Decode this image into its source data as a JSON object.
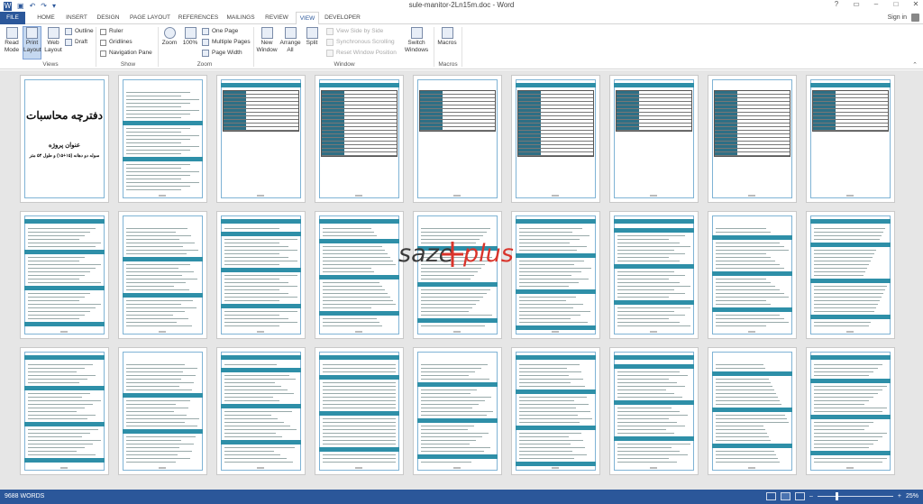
{
  "window": {
    "title": "sule-manitor-2Ln15m.doc - Word",
    "sign_in": "Sign in",
    "controls": [
      "?",
      "▭",
      "–",
      "□",
      "✕"
    ]
  },
  "tabs": [
    "FILE",
    "HOME",
    "INSERT",
    "DESIGN",
    "PAGE LAYOUT",
    "REFERENCES",
    "MAILINGS",
    "REVIEW",
    "VIEW",
    "DEVELOPER"
  ],
  "active_tab": "VIEW",
  "ribbon": {
    "views": {
      "label": "Views",
      "read_mode": "Read Mode",
      "print_layout": "Print Layout",
      "web_layout": "Web Layout",
      "outline": "Outline",
      "draft": "Draft"
    },
    "show": {
      "label": "Show",
      "ruler": "Ruler",
      "gridlines": "Gridlines",
      "navigation_pane": "Navigation Pane"
    },
    "zoom": {
      "label": "Zoom",
      "zoom": "Zoom",
      "hundred": "100%",
      "one_page": "One Page",
      "multiple_pages": "Multiple Pages",
      "page_width": "Page Width"
    },
    "window": {
      "label": "Window",
      "new_window": "New Window",
      "arrange_all": "Arrange All",
      "split": "Split",
      "view_side_by_side": "View Side by Side",
      "synchronous_scrolling": "Synchronous Scrolling",
      "reset_window_position": "Reset Window Position",
      "switch_windows": "Switch Windows"
    },
    "macros": {
      "label": "Macros",
      "macros": "Macros"
    }
  },
  "cover_page": {
    "title": "دفترچه محاسبات",
    "subtitle": "عنوان پروژه",
    "subtitle2": "سوله دو دهانه (۱۵+۱۵) و طول ۵۴ متر"
  },
  "watermark": {
    "text_left": "saze",
    "text_right": "plus"
  },
  "status": {
    "words": "9688 WORDS",
    "zoom": "25%",
    "zoom_level": 0.25
  }
}
